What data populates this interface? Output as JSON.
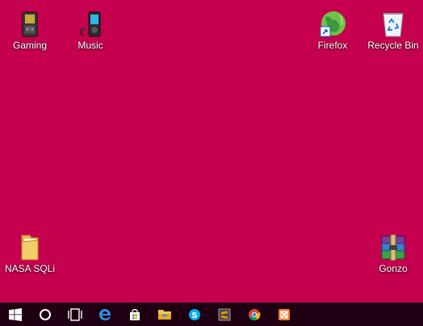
{
  "colors": {
    "desktop_background": "#c5004f",
    "taskbar_background": "#1f0012",
    "label_color": "#ffffff"
  },
  "desktop": {
    "icons": [
      {
        "name": "gaming",
        "label": "Gaming",
        "icon": "handheld-device-icon"
      },
      {
        "name": "music",
        "label": "Music",
        "icon": "mp3-player-icon"
      },
      {
        "name": "firefox",
        "label": "Firefox",
        "icon": "firefox-globe-icon",
        "shortcut": true
      },
      {
        "name": "recycle-bin",
        "label": "Recycle Bin",
        "icon": "recycle-bin-icon"
      },
      {
        "name": "nasa-sqli",
        "label": "NASA SQLi",
        "icon": "folder-icon"
      },
      {
        "name": "gonzo",
        "label": "Gonzo",
        "icon": "winrar-archive-icon"
      }
    ]
  },
  "taskbar": {
    "buttons": [
      {
        "name": "start",
        "icon": "windows-logo-icon"
      },
      {
        "name": "cortana",
        "icon": "search-circle-icon"
      },
      {
        "name": "task-view",
        "icon": "task-view-icon"
      },
      {
        "name": "edge",
        "icon": "edge-browser-icon"
      },
      {
        "name": "store",
        "icon": "store-bag-icon"
      },
      {
        "name": "file-explorer",
        "icon": "folder-icon"
      },
      {
        "name": "skype",
        "icon": "skype-icon"
      },
      {
        "name": "sublime",
        "icon": "code-editor-icon"
      },
      {
        "name": "chrome",
        "icon": "chrome-icon"
      },
      {
        "name": "xampp",
        "icon": "xampp-icon"
      }
    ]
  }
}
